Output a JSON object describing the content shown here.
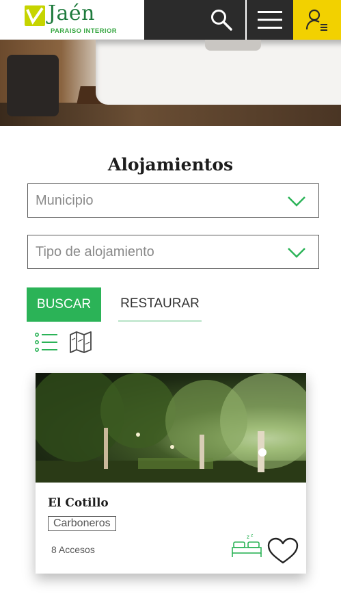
{
  "header": {
    "logo_text": "Jaén",
    "logo_subtitle": "PARAISO INTERIOR",
    "icons": [
      "search-icon",
      "menu-icon",
      "user-menu-icon"
    ],
    "colors": {
      "dark": "#2b2b2b",
      "yellow": "#f2d100",
      "brand_green": "#1e7a3c"
    }
  },
  "page": {
    "title": "Alojamientos"
  },
  "filters": {
    "municipio_placeholder": "Municipio",
    "tipo_placeholder": "Tipo de alojamiento",
    "buscar_label": "BUSCAR",
    "restaurar_label": "RESTAURAR",
    "accent": "#2bb357"
  },
  "views": {
    "icons": [
      "list-view-icon",
      "map-view-icon"
    ]
  },
  "results": [
    {
      "name": "El Cotillo",
      "municipio": "Carboneros",
      "accesos": "8 Accesos",
      "icons": [
        "bed-icon",
        "heart-icon"
      ]
    }
  ]
}
